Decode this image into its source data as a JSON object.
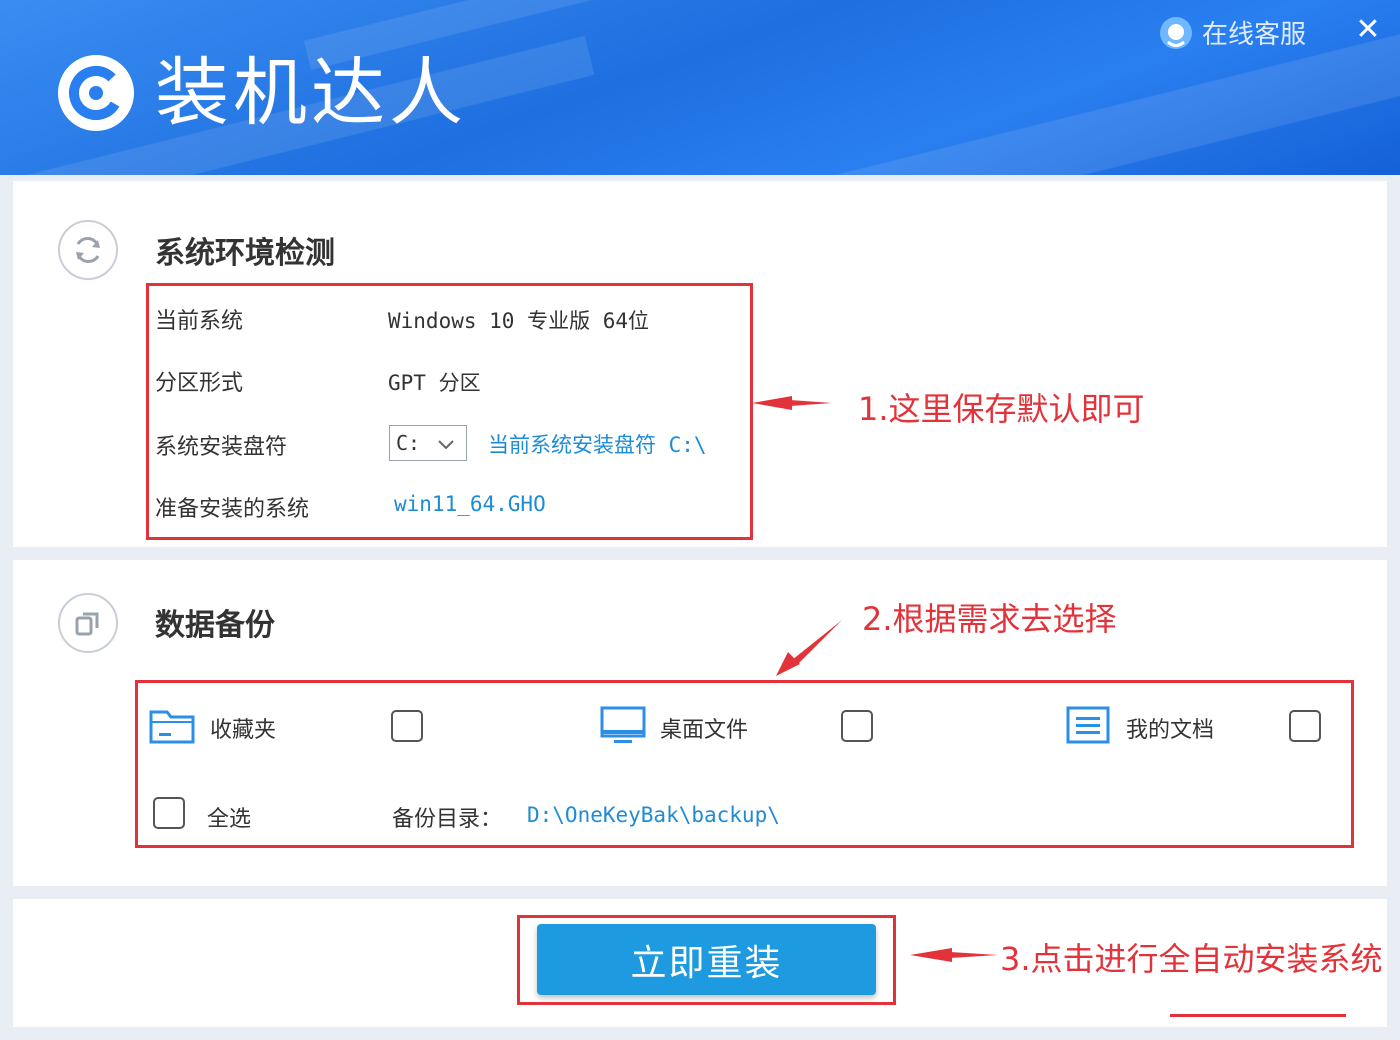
{
  "app": {
    "title": "装机达人",
    "online_service": "在线客服",
    "close_glyph": "✕"
  },
  "system_check": {
    "title": "系统环境检测",
    "rows": [
      {
        "label": "当前系统",
        "value": "Windows 10 专业版 64位"
      },
      {
        "label": "分区形式",
        "value": "GPT 分区"
      },
      {
        "label": "系统安装盘符",
        "select_value": "C:",
        "hint": "当前系统安装盘符 C:\\"
      },
      {
        "label": "准备安装的系统",
        "value": "win11_64.GHO"
      }
    ]
  },
  "backup": {
    "title": "数据备份",
    "items": [
      {
        "label": "收藏夹",
        "icon": "folder-icon"
      },
      {
        "label": "桌面文件",
        "icon": "monitor-icon"
      },
      {
        "label": "我的文档",
        "icon": "document-icon"
      }
    ],
    "select_all": "全选",
    "dir_label": "备份目录：",
    "dir_value": "D:\\OneKeyBak\\backup\\"
  },
  "action": {
    "reinstall_label": "立即重装"
  },
  "annotations": {
    "a1": "1.这里保存默认即可",
    "a2": "2.根据需求去选择",
    "a3": "3.点击进行全自动安装系统"
  },
  "colors": {
    "accent": "#1d9ae0",
    "annotation": "#e3333a",
    "header": "#1e6fe0",
    "link": "#1e8bd6"
  }
}
